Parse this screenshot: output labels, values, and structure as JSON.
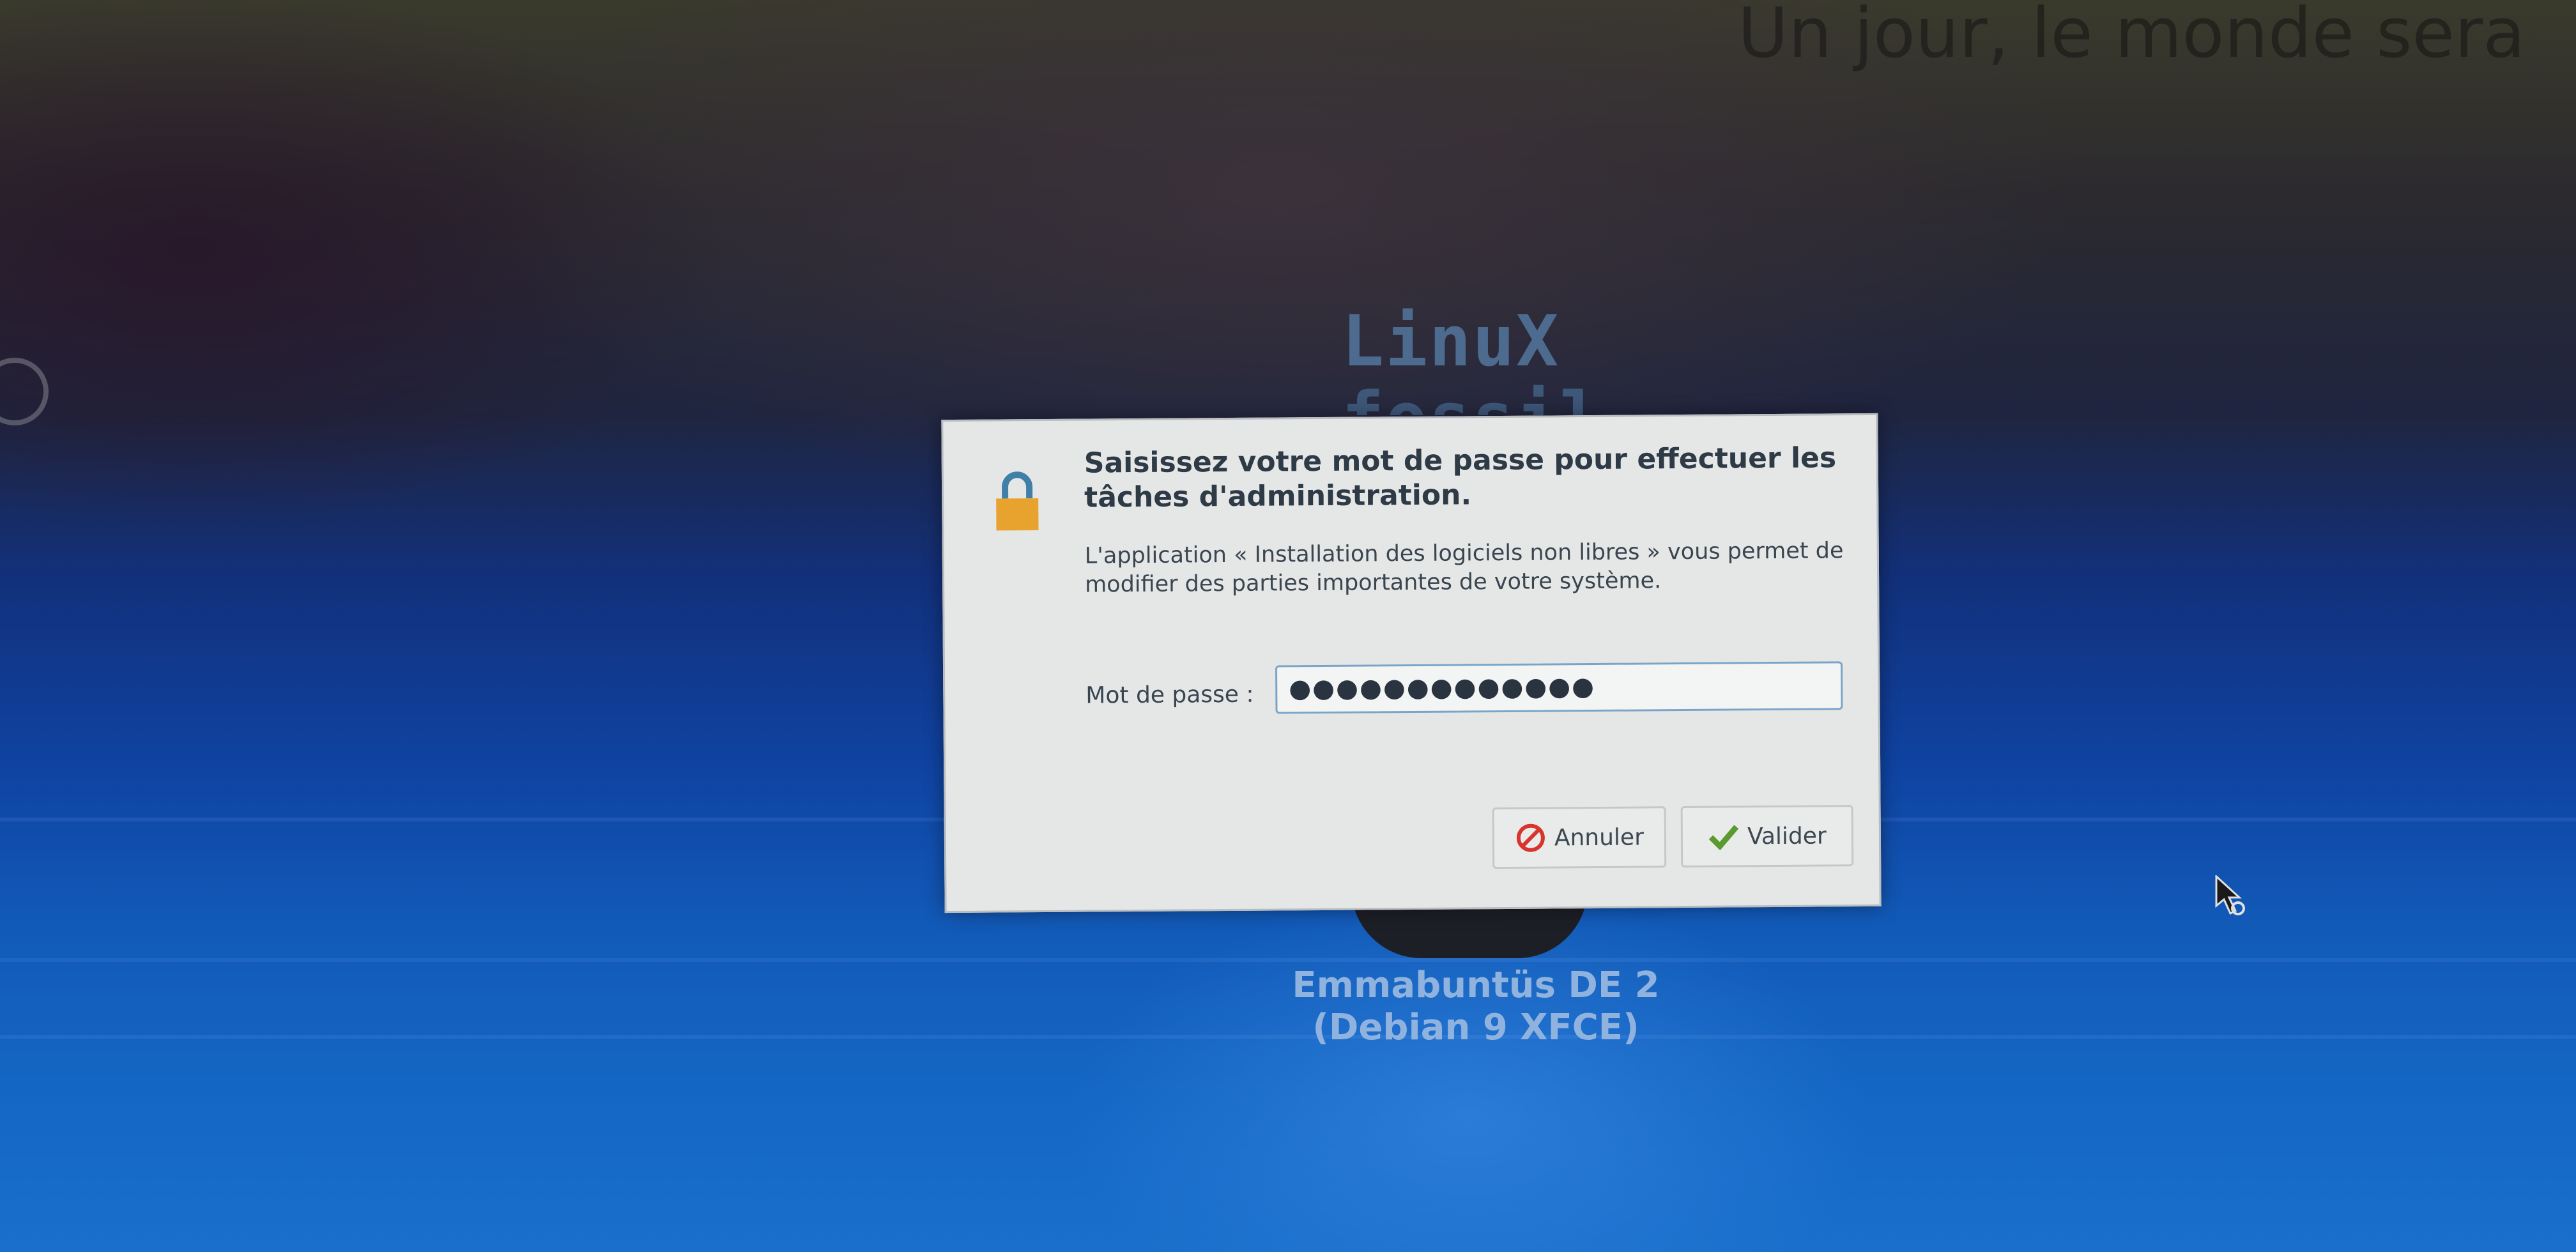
{
  "wallpaper": {
    "top_text": "Un jour, le monde sera",
    "logo_line1": "LinuX",
    "logo_line2": "fossil",
    "distro_line1": "Emmabuntüs DE 2",
    "distro_line2": "(Debian 9 XFCE)"
  },
  "dialog": {
    "title": "Saisissez votre mot de passe pour effectuer les tâches d'administration.",
    "body": "L'application « Installation des logiciels non libres » vous permet de modifier des parties importantes de votre système.",
    "password_label": "Mot de passe :",
    "password_value": "●●●●●●●●●●●●●",
    "cancel_label": "Annuler",
    "ok_label": "Valider",
    "icons": {
      "lock": "lock-icon",
      "cancel": "prohibited-icon",
      "ok": "checkmark-icon"
    },
    "colors": {
      "lock_body": "#e8a32e",
      "lock_shackle": "#3f7fa8",
      "cancel_icon": "#d9342b",
      "ok_icon": "#5a9a2f"
    }
  }
}
